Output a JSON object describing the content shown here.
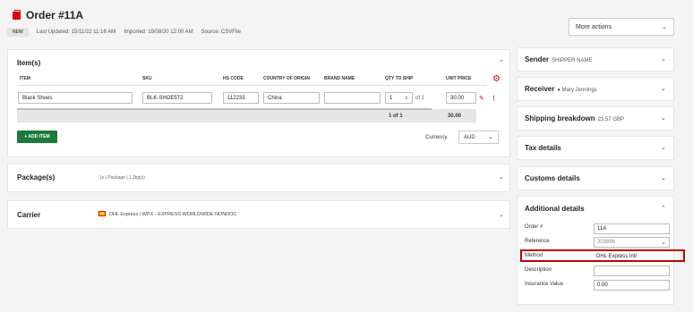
{
  "header": {
    "title": "Order #11A",
    "badge": "NEW",
    "last_updated": "Last Updated: 15/11/22 11:16 AM",
    "imported": "Imported: 19/08/20 12:00 AM",
    "source": "Source: CSVFile",
    "more_actions": "More actions"
  },
  "items": {
    "title": "Item(s)",
    "columns": [
      "ITEM",
      "SKU",
      "HS CODE",
      "COUNTRY OF ORIGIN",
      "BRAND NAME",
      "QTY TO SHIP",
      "UNIT PRICE"
    ],
    "row": {
      "item": "Black Shoes",
      "sku": "BLK-SHOE572",
      "hs_code": "112233",
      "country": "China",
      "brand": "",
      "qty": "1",
      "qty_of": "of 1",
      "unit_price": "30.00"
    },
    "totals": {
      "qty": "1 of 1",
      "price": "30.00"
    },
    "add_item": "+ ADD ITEM",
    "currency_label": "Currency",
    "currency_value": "AUD"
  },
  "packages": {
    "title": "Package(s)",
    "summary": "1x | Package | 1.2kg(s)"
  },
  "carrier": {
    "title": "Carrier",
    "value": "DHL Express | WPX - EXPRESS WORLDWIDE NONDOC"
  },
  "right": {
    "sender": {
      "title": "Sender",
      "sub": "SHIPPER NAME"
    },
    "receiver": {
      "title": "Receiver",
      "sub": "Mary Jennings"
    },
    "shipping": {
      "title": "Shipping breakdown",
      "sub": "23.57 GBP"
    },
    "tax": {
      "title": "Tax details"
    },
    "customs": {
      "title": "Customs details"
    },
    "additional": {
      "title": "Additional details",
      "fields": {
        "order_label": "Order #",
        "order_value": "11A",
        "reference_label": "Reference",
        "reference_value": "203886",
        "method_label": "Method",
        "method_value": "DHL Express Intl",
        "description_label": "Description",
        "description_value": "",
        "insurance_label": "Insurance Value",
        "insurance_value": "0.00"
      }
    }
  },
  "colors": {
    "accent": "#d40511",
    "add_button": "#1c7a3a",
    "highlight_border": "#c00000"
  }
}
